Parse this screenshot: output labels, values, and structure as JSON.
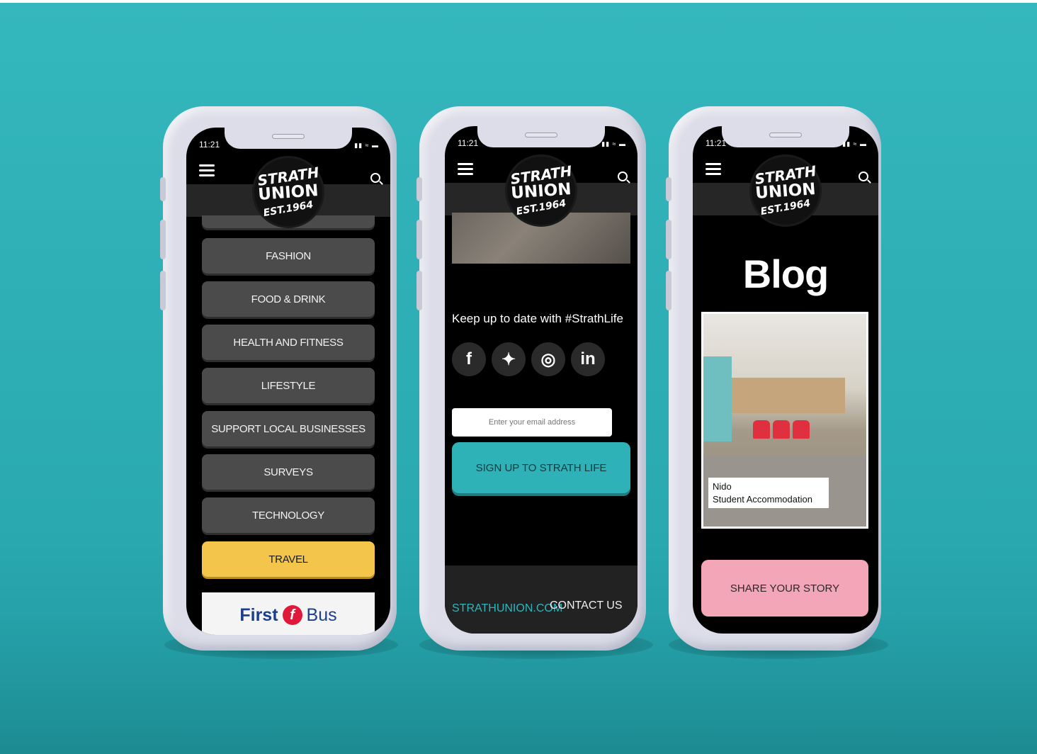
{
  "status": {
    "time": "11:21"
  },
  "logo": {
    "line1": "STRATH",
    "line2": "UNION",
    "line3": "EST.1964"
  },
  "phone1": {
    "categories": [
      {
        "label": "FASHION"
      },
      {
        "label": "FOOD & DRINK"
      },
      {
        "label": "HEALTH AND FITNESS"
      },
      {
        "label": "LIFESTYLE"
      },
      {
        "label": "SUPPORT LOCAL BUSINESSES"
      },
      {
        "label": "SURVEYS"
      },
      {
        "label": "TECHNOLOGY"
      },
      {
        "label": "TRAVEL"
      }
    ],
    "ad": {
      "first": "First",
      "mark": "f",
      "bus": "Bus"
    }
  },
  "phone2": {
    "tagline": "Keep up to date with #StrathLife",
    "social": [
      {
        "glyph": "f",
        "icon": "facebook-icon"
      },
      {
        "glyph": "✦",
        "icon": "twitter-icon"
      },
      {
        "glyph": "◎",
        "icon": "instagram-icon"
      },
      {
        "glyph": "in",
        "icon": "linkedin-icon"
      }
    ],
    "email_placeholder": "Enter your email address",
    "signup_label": "SIGN UP TO STRATH LIFE",
    "footer": {
      "site": "STRATHUNION.COM",
      "contact": "CONTACT US"
    }
  },
  "phone3": {
    "title": "Blog",
    "card": {
      "line1": "Nido",
      "line2": "Student Accommodation"
    },
    "share_label": "SHARE YOUR STORY"
  },
  "colors": {
    "background": "#2aa9b0",
    "travel_yellow": "#f3c54a",
    "signup_teal": "#2fb1b8",
    "share_pink": "#f2a6b7"
  }
}
